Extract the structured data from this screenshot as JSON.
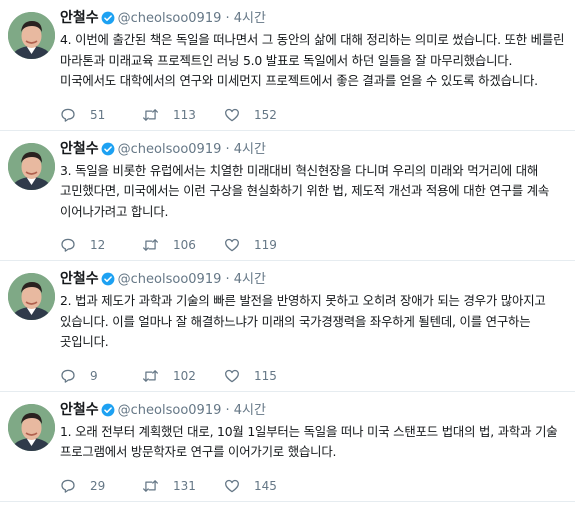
{
  "tweets": [
    {
      "author": "안철수",
      "handle": "@cheolsoo0919",
      "separator": "·",
      "time": "4시간",
      "text": "4. 이번에 출간된 책은 독일을 떠나면서 그 동안의 삶에 대해 정리하는 의미로 썼습니다. 또한 베를린 마라톤과 미래교육 프로젝트인 러닝 5.0 발표로 독일에서 하던 일들을 잘 마무리했습니다. 미국에서도 대학에서의 연구와 미세먼지 프로젝트에서 좋은 결과를 얻을 수 있도록 하겠습니다.",
      "replies": "51",
      "retweets": "113",
      "likes": "152"
    },
    {
      "author": "안철수",
      "handle": "@cheolsoo0919",
      "separator": "·",
      "time": "4시간",
      "text": "3. 독일을 비롯한 유럽에서는 치열한 미래대비 혁신현장을 다니며 우리의 미래와 먹거리에 대해 고민했다면, 미국에서는 이런 구상을 현실화하기 위한 법, 제도적 개선과 적용에 대한 연구를 계속 이어나가려고 합니다.",
      "replies": "12",
      "retweets": "106",
      "likes": "119"
    },
    {
      "author": "안철수",
      "handle": "@cheolsoo0919",
      "separator": "·",
      "time": "4시간",
      "text": "2. 법과 제도가 과학과 기술의 빠른 발전을 반영하지 못하고 오히려 장애가 되는 경우가 많아지고 있습니다. 이를 얼마나 잘 해결하느냐가 미래의 국가경쟁력을 좌우하게 될텐데, 이를 연구하는 곳입니다.",
      "replies": "9",
      "retweets": "102",
      "likes": "115"
    },
    {
      "author": "안철수",
      "handle": "@cheolsoo0919",
      "separator": "·",
      "time": "4시간",
      "text": "1. 오래 전부터 계획했던 대로, 10월 1일부터는 독일을 떠나 미국 스탠포드 법대의 법, 과학과 기술 프로그램에서 방문학자로 연구를 이어가기로 했습니다.",
      "replies": "29",
      "retweets": "131",
      "likes": "145"
    }
  ],
  "colors": {
    "verified": "#1da1f2",
    "muted": "#657786",
    "text": "#14171a",
    "divider": "#e6ecf0"
  },
  "icons": [
    "verified-badge-icon",
    "reply-icon",
    "retweet-icon",
    "like-icon"
  ]
}
